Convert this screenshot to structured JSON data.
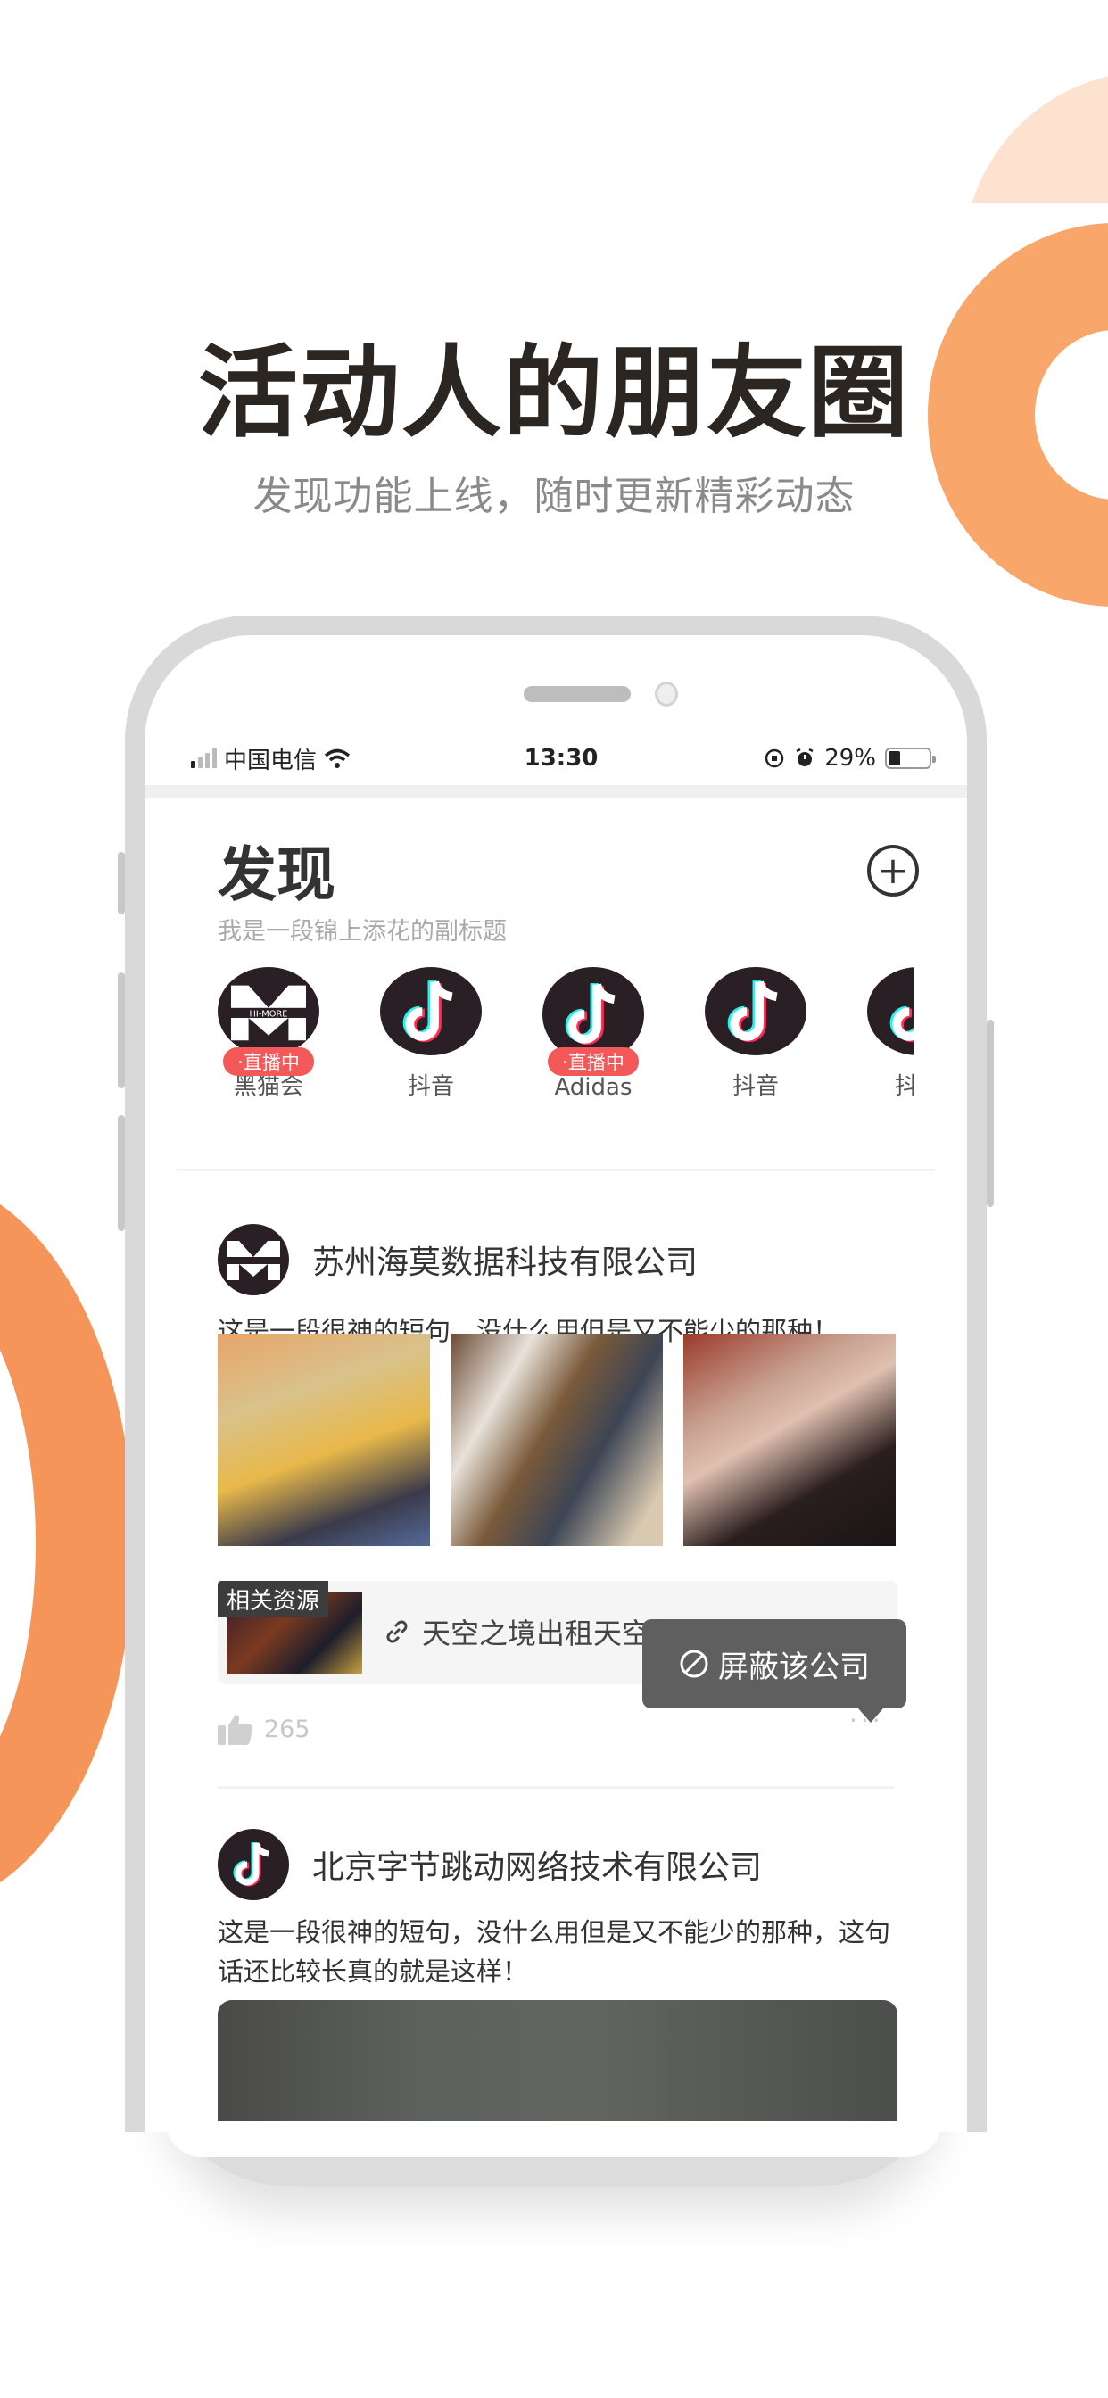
{
  "hero": {
    "title": "活动人的朋友圈",
    "subtitle": "发现功能上线，随时更新精彩动态"
  },
  "colors": {
    "accent_orange": "#f9a66b",
    "accent_pale": "#fde2d0",
    "live_red": "#f4595a",
    "tooltip_bg": "#5f5f5f"
  },
  "status_bar": {
    "carrier": "中国电信",
    "time": "13:30",
    "battery_percent_label": "29%",
    "battery_level": 0.29,
    "icons": [
      "signal-icon",
      "wifi-icon",
      "orientation-lock-icon",
      "alarm-icon",
      "battery-icon"
    ]
  },
  "header": {
    "title": "发现",
    "subtitle": "我是一段锦上添花的副标题",
    "add_icon": "plus-circle-icon"
  },
  "stories": [
    {
      "name": "黑猫会",
      "logo": "hi-more",
      "live": true,
      "live_label": "·直播中"
    },
    {
      "name": "抖音",
      "logo": "tiktok",
      "live": false
    },
    {
      "name": "Adidas",
      "logo": "tiktok",
      "live": true,
      "live_label": "·直播中"
    },
    {
      "name": "抖音",
      "logo": "tiktok",
      "live": false
    },
    {
      "name": "抖音",
      "logo": "tiktok",
      "live": false
    }
  ],
  "posts": [
    {
      "company": "苏州海莫数据科技有限公司",
      "logo": "hi-more",
      "text": "这是一段很神的短句，没什么用但是又不能少的那种！",
      "photos": [
        "photo-megaphone-volunteers",
        "photo-office-meeting",
        "photo-woman-red-light"
      ],
      "resource": {
        "tag": "相关资源",
        "link_text": "天空之境出租天空之境道具现货"
      },
      "likes": "265",
      "menu": {
        "block_label": "屏蔽该公司"
      }
    },
    {
      "company": "北京字节跳动网络技术有限公司",
      "logo": "tiktok",
      "text": "这是一段很神的短句，没什么用但是又不能少的那种，这句话还比较长真的就是这样！",
      "photos": [
        "photo-group-laughing"
      ]
    }
  ]
}
